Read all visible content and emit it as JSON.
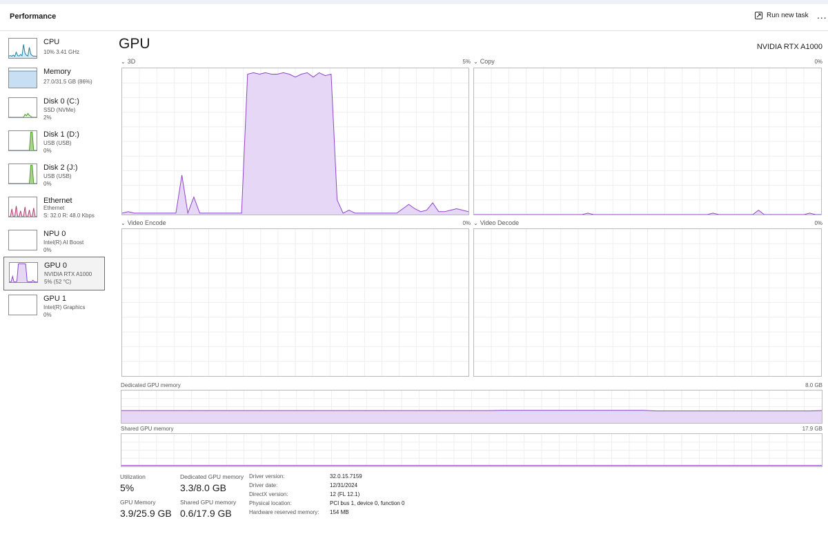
{
  "header": {
    "title": "Performance",
    "run_new_task": "Run new task",
    "more": "..."
  },
  "sidebar": {
    "items": [
      {
        "title": "CPU",
        "line1": "10% 3.41 GHz",
        "line2": "",
        "line3": ""
      },
      {
        "title": "Memory",
        "line1": "27.0/31.5 GB (86%)",
        "line2": "",
        "line3": ""
      },
      {
        "title": "Disk 0 (C:)",
        "line1": "SSD (NVMe)",
        "line2": "2%",
        "line3": ""
      },
      {
        "title": "Disk 1 (D:)",
        "line1": "USB (USB)",
        "line2": "0%",
        "line3": ""
      },
      {
        "title": "Disk 2 (J:)",
        "line1": "USB (USB)",
        "line2": "0%",
        "line3": ""
      },
      {
        "title": "Ethernet",
        "line1": "Ethernet",
        "line2": "S: 32.0 R: 48.0 Kbps",
        "line3": ""
      },
      {
        "title": "NPU 0",
        "line1": "Intel(R) AI Boost",
        "line2": "0%",
        "line3": ""
      },
      {
        "title": "GPU 0",
        "line1": "NVIDIA RTX A1000",
        "line2": "5% (52 °C)",
        "line3": ""
      },
      {
        "title": "GPU 1",
        "line1": "Intel(R) Graphics",
        "line2": "0%",
        "line3": ""
      }
    ]
  },
  "main": {
    "title": "GPU",
    "gpu_name": "NVIDIA RTX A1000",
    "engines": [
      {
        "label": "3D",
        "value": "5%"
      },
      {
        "label": "Copy",
        "value": "0%"
      },
      {
        "label": "Video Encode",
        "value": "0%"
      },
      {
        "label": "Video Decode",
        "value": "0%"
      }
    ],
    "dedicated_memory_label": "Dedicated GPU memory",
    "dedicated_memory_max": "8.0 GB",
    "shared_memory_label": "Shared GPU memory",
    "shared_memory_max": "17.9 GB"
  },
  "stats": {
    "utilization_label": "Utilization",
    "utilization": "5%",
    "dedicated_label": "Dedicated GPU memory",
    "dedicated": "3.3/8.0 GB",
    "gpu_memory_label": "GPU Memory",
    "gpu_memory": "3.9/25.9 GB",
    "shared_label": "Shared GPU memory",
    "shared": "0.6/17.9 GB"
  },
  "info": {
    "driver_version_label": "Driver version:",
    "driver_version": "32.0.15.7159",
    "driver_date_label": "Driver date:",
    "driver_date": "12/31/2024",
    "directx_label": "DirectX version:",
    "directx": "12 (FL 12.1)",
    "physical_location_label": "Physical location:",
    "physical_location": "PCI bus 1, device 0, function 0",
    "hw_reserved_label": "Hardware reserved memory:",
    "hw_reserved": "154 MB"
  },
  "colors": {
    "gpu_line": "#8e44c9",
    "gpu_fill": "#e6d7f6",
    "grid": "#eeeeee",
    "cpu_line": "#1a7fa3",
    "memory_fill": "#c8dff3",
    "disk_line": "#4e9a2a",
    "eth_line": "#b53a6e"
  },
  "history": {
    "gpu3d": [
      1,
      2,
      1,
      1,
      1,
      1,
      1,
      1,
      1,
      1,
      27,
      1,
      12,
      1,
      1,
      1,
      1,
      1,
      1,
      1,
      1,
      96,
      97,
      96,
      97,
      96,
      96,
      97,
      96,
      94,
      96,
      97,
      94,
      97,
      95,
      96,
      10,
      1,
      3,
      1,
      1,
      1,
      1,
      1,
      1,
      1,
      1,
      4,
      7,
      4,
      2,
      3,
      8,
      2,
      2,
      3,
      4,
      3,
      2
    ],
    "copy": [
      0,
      0,
      0,
      0,
      0,
      0,
      0,
      0,
      0,
      0,
      0,
      0,
      0,
      0,
      0,
      0,
      0,
      0,
      0,
      0,
      1,
      0,
      0,
      0,
      0,
      0,
      0,
      0,
      0,
      0,
      0,
      0,
      0,
      0,
      0,
      0,
      0,
      0,
      0,
      0,
      0,
      0,
      1,
      0,
      0,
      0,
      0,
      0,
      0,
      0,
      3,
      0,
      0,
      0,
      0,
      0,
      0,
      0,
      0,
      1,
      0,
      0
    ],
    "dedicated": [
      38,
      38,
      38,
      38,
      38,
      38,
      38,
      38,
      38,
      38,
      38,
      38,
      38,
      38,
      38,
      38,
      38,
      38,
      38,
      38,
      38,
      38,
      38,
      38,
      38,
      38,
      38,
      38,
      38,
      38,
      38,
      38,
      39,
      39,
      39,
      39,
      39,
      39,
      39,
      39,
      39,
      39,
      39,
      39,
      39,
      37,
      37,
      37,
      37,
      37,
      37,
      37,
      37,
      37,
      37,
      37,
      37,
      37,
      37,
      38
    ],
    "shared": [
      3,
      3,
      3,
      3,
      3,
      3,
      3,
      3,
      3,
      3,
      3,
      3,
      3,
      3,
      3,
      3,
      3,
      3,
      3,
      3,
      3,
      3,
      3,
      3,
      3,
      3,
      3,
      3,
      3,
      3,
      3,
      3,
      3,
      3,
      3,
      3,
      3,
      3,
      3,
      3,
      3,
      3,
      3,
      3,
      3,
      3,
      3,
      3,
      3,
      3,
      3,
      3,
      3,
      3,
      3,
      3,
      3,
      3,
      3,
      3
    ],
    "thumb_cpu": [
      10,
      12,
      9,
      15,
      8,
      30,
      12,
      10,
      18,
      11,
      70,
      25,
      14,
      10,
      55,
      20,
      12,
      9,
      10,
      8
    ],
    "thumb_disk0": [
      0,
      0,
      0,
      0,
      0,
      0,
      0,
      0,
      0,
      0,
      0,
      15,
      8,
      20,
      10,
      5,
      0,
      0,
      0,
      0
    ],
    "thumb_disk1": [
      0,
      0,
      0,
      0,
      0,
      0,
      0,
      0,
      0,
      0,
      0,
      0,
      0,
      0,
      0,
      95,
      95,
      0,
      0,
      0
    ],
    "thumb_disk2": [
      0,
      0,
      0,
      0,
      0,
      0,
      0,
      0,
      0,
      0,
      0,
      0,
      0,
      0,
      0,
      95,
      95,
      0,
      0,
      0
    ],
    "thumb_eth": [
      0,
      0,
      40,
      0,
      0,
      55,
      0,
      0,
      30,
      0,
      0,
      50,
      0,
      0,
      35,
      0,
      0,
      45,
      0,
      0
    ],
    "thumb_gpu0": [
      1,
      2,
      30,
      1,
      1,
      5,
      95,
      96,
      95,
      96,
      95,
      94,
      5,
      1,
      2,
      1,
      10,
      2,
      1,
      1
    ]
  }
}
